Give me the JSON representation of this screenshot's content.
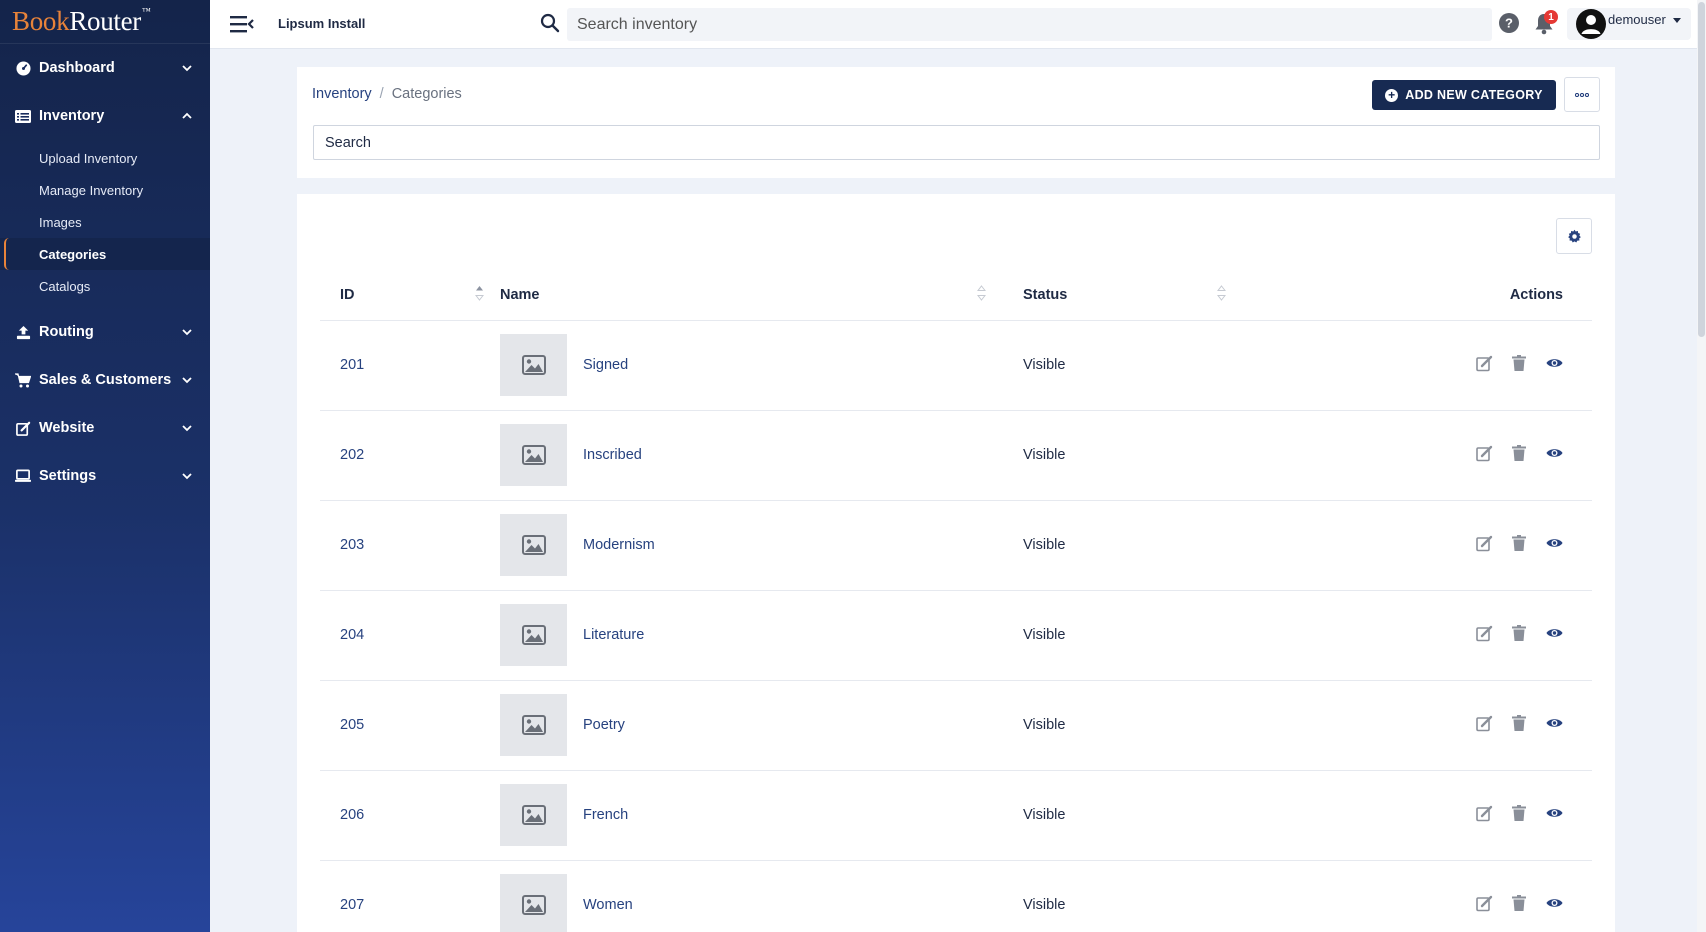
{
  "brand": {
    "book": "Book",
    "router": "Router",
    "tm": "™"
  },
  "sidebar": {
    "items": [
      {
        "label": "Dashboard",
        "icon": "dashboard-icon"
      },
      {
        "label": "Inventory",
        "icon": "inventory-list-icon",
        "expanded": true,
        "children": [
          "Upload Inventory",
          "Manage Inventory",
          "Images",
          "Categories",
          "Catalogs"
        ],
        "active_child": "Categories"
      },
      {
        "label": "Routing",
        "icon": "routing-upload-icon"
      },
      {
        "label": "Sales & Customers",
        "icon": "cart-icon"
      },
      {
        "label": "Website",
        "icon": "edit-square-icon"
      },
      {
        "label": "Settings",
        "icon": "laptop-icon"
      }
    ]
  },
  "topbar": {
    "store_name": "Lipsum Install",
    "search_placeholder": "Search inventory",
    "notification_count": "1",
    "username": "demouser"
  },
  "header": {
    "breadcrumb": {
      "parent": "Inventory",
      "separator": "/",
      "current": "Categories"
    },
    "add_button_label": "ADD NEW CATEGORY",
    "search_placeholder": "Search"
  },
  "table": {
    "columns": {
      "id": "ID",
      "name": "Name",
      "status": "Status",
      "actions": "Actions"
    },
    "rows": [
      {
        "id": "201",
        "name": "Signed",
        "status": "Visible"
      },
      {
        "id": "202",
        "name": "Inscribed",
        "status": "Visible"
      },
      {
        "id": "203",
        "name": "Modernism",
        "status": "Visible"
      },
      {
        "id": "204",
        "name": "Literature",
        "status": "Visible"
      },
      {
        "id": "205",
        "name": "Poetry",
        "status": "Visible"
      },
      {
        "id": "206",
        "name": "French",
        "status": "Visible"
      },
      {
        "id": "207",
        "name": "Women",
        "status": "Visible"
      }
    ]
  },
  "colors": {
    "accent": "#e8833a",
    "primary": "#172a52",
    "link": "#27427f",
    "badge": "#e53935"
  }
}
